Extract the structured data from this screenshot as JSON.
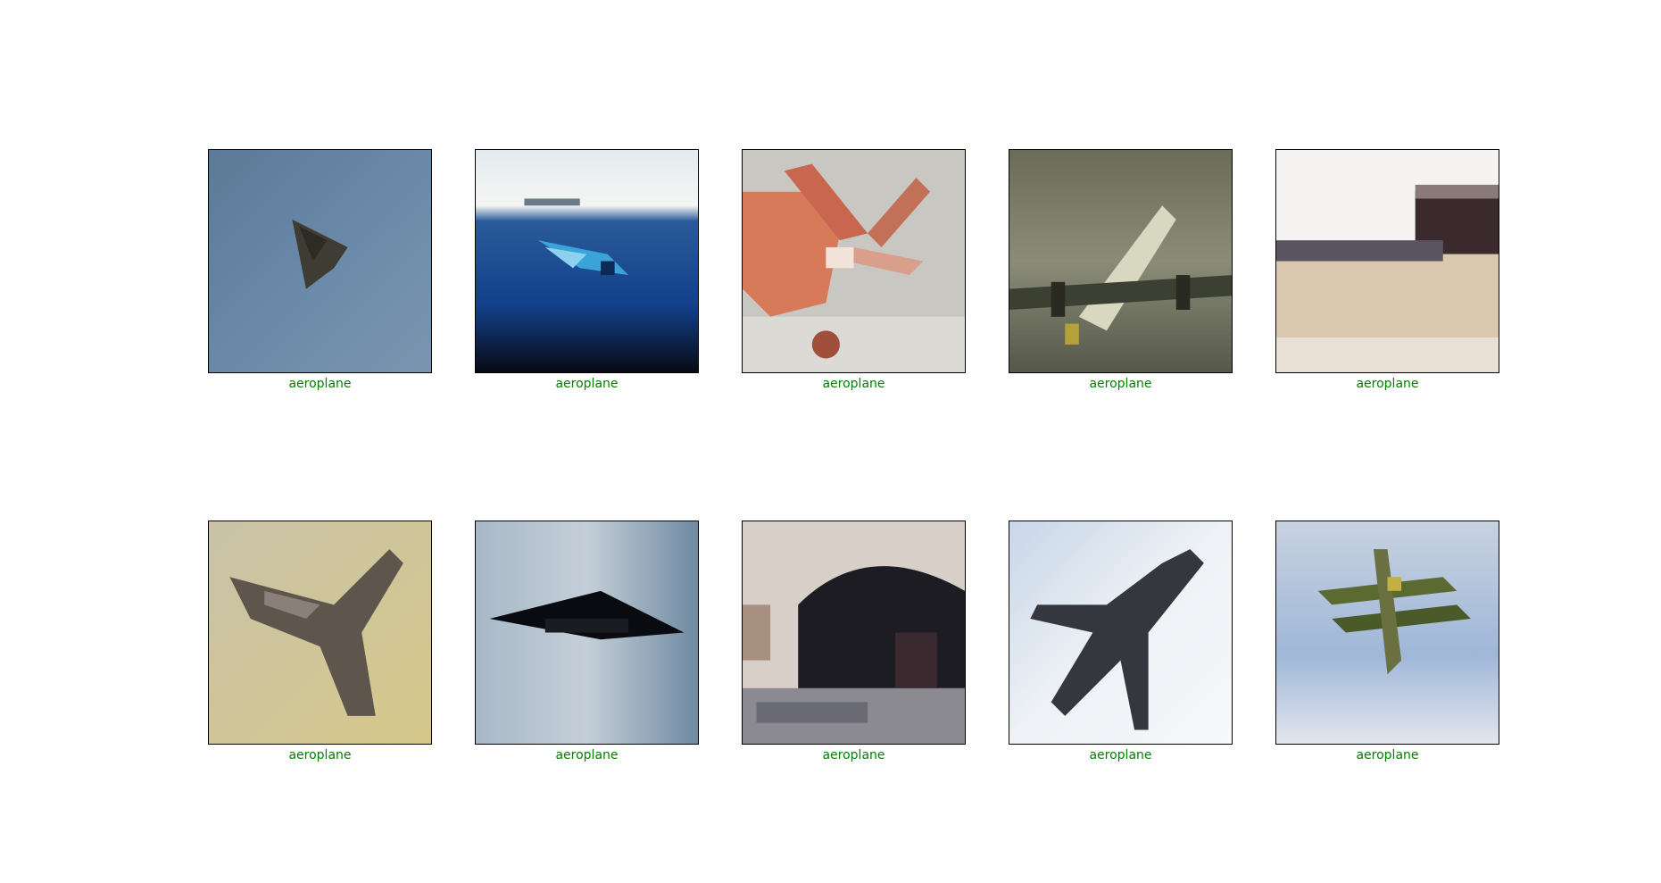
{
  "label_color": "#008000",
  "images": [
    {
      "label": "aeroplane"
    },
    {
      "label": "aeroplane"
    },
    {
      "label": "aeroplane"
    },
    {
      "label": "aeroplane"
    },
    {
      "label": "aeroplane"
    },
    {
      "label": "aeroplane"
    },
    {
      "label": "aeroplane"
    },
    {
      "label": "aeroplane"
    },
    {
      "label": "aeroplane"
    },
    {
      "label": "aeroplane"
    }
  ]
}
